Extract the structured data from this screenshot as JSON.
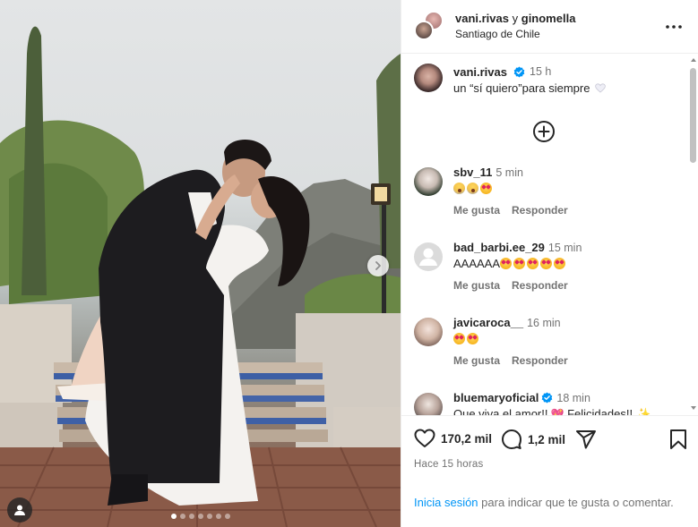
{
  "header": {
    "user1": "vani.rivas",
    "conjunction": "y",
    "user2": "ginomella",
    "location": "Santiago de Chile"
  },
  "caption": {
    "username": "vani.rivas",
    "time": "15 h",
    "text": "un “sí quiero”para siempre"
  },
  "comments": [
    {
      "username": "sbv_11",
      "time": "5 min",
      "text": "",
      "like": "Me gusta",
      "reply": "Responder"
    },
    {
      "username": "bad_barbi.ee_29",
      "time": "15 min",
      "text": "AAAAAA",
      "like": "Me gusta",
      "reply": "Responder"
    },
    {
      "username": "javicaroca__",
      "time": "16 min",
      "text": "",
      "like": "Me gusta",
      "reply": "Responder"
    },
    {
      "username": "bluemaryoficial",
      "time": "18 min",
      "text": "Que viva el amor!!",
      "text2": "Felicidades!!"
    }
  ],
  "footer": {
    "likes": "170,2 mil",
    "comments": "1,2 mil",
    "posted": "Hace 15 horas",
    "login_link": "Inicia sesión",
    "login_rest": " para indicar que te gusta o comentar."
  },
  "carousel": {
    "slides": 7,
    "active_index": 0
  },
  "colors": {
    "link": "#0095f6",
    "verified": "#0095f6",
    "muted": "#737373",
    "text": "#262626"
  },
  "icons": [
    "heart-icon",
    "comment-icon",
    "share-icon",
    "save-icon",
    "more-icon",
    "plus-circle-icon",
    "verified-icon",
    "chevron-right-icon",
    "user-tag-icon"
  ]
}
